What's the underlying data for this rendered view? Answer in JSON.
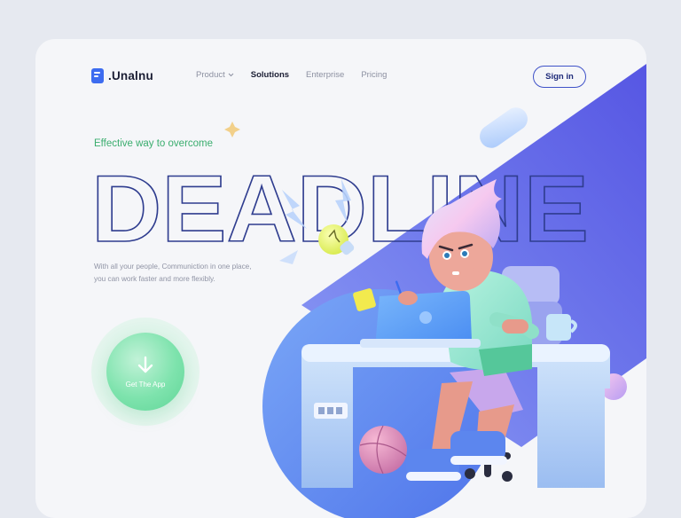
{
  "brand": {
    "name": ".Unalnu"
  },
  "nav": {
    "items": [
      {
        "label": "Product",
        "has_dropdown": true,
        "active": false
      },
      {
        "label": "Solutions",
        "has_dropdown": false,
        "active": true
      },
      {
        "label": "Enterprise",
        "has_dropdown": false,
        "active": false
      },
      {
        "label": "Pricing",
        "has_dropdown": false,
        "active": false
      }
    ],
    "sign_in_label": "Sign in"
  },
  "hero": {
    "eyebrow": "Effective way to overcome",
    "headline": "DEADLINE",
    "description_line1": "With all your people, Communiction in one place,",
    "description_line2": "you can work faster and more flexibly.",
    "cta_label": "Get The App"
  },
  "icons": {
    "logo": "app-logo-icon",
    "chevron": "chevron-down-icon",
    "cta": "download-arrow-icon",
    "illustration": "person-at-desk-illustration"
  },
  "colors": {
    "accent_blue": "#5b63e8",
    "accent_green": "#3aad6e",
    "headline_stroke": "#2f3d8f",
    "card_bg": "#f5f6f9"
  }
}
